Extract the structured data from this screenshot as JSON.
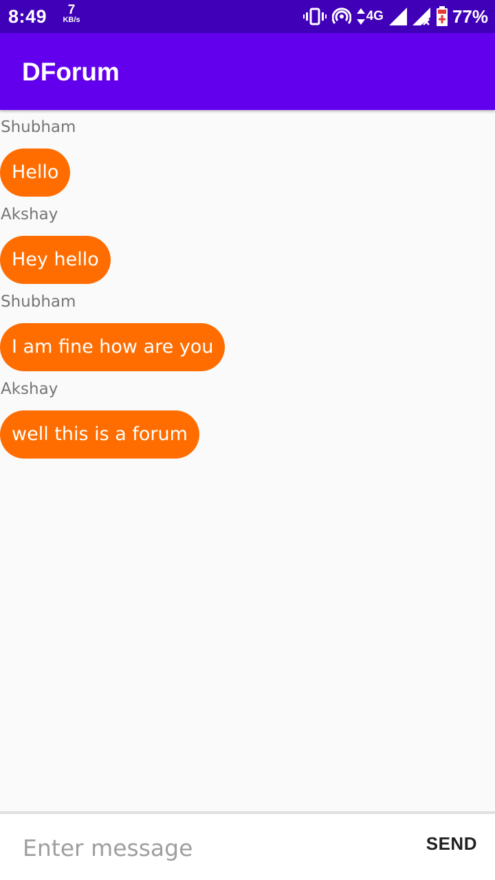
{
  "status_bar": {
    "time": "8:49",
    "speed_value": "7",
    "speed_unit": "KB/s",
    "network_type": "4G",
    "battery_percent": "77%",
    "icons": [
      "vibrate-icon",
      "hotspot-icon",
      "data-arrows-icon",
      "signal-icon",
      "signal-no-service-icon",
      "battery-charging-icon"
    ],
    "background_color": "#3f00b8"
  },
  "app_bar": {
    "title": "DForum",
    "background_color": "#6200ee"
  },
  "messages": [
    {
      "sender": "Shubham",
      "text": "Hello"
    },
    {
      "sender": "Akshay",
      "text": "Hey hello"
    },
    {
      "sender": "Shubham",
      "text": "I am fine how are you"
    },
    {
      "sender": "Akshay",
      "text": "well this is a forum"
    }
  ],
  "bubble_color": "#ff6d00",
  "composer": {
    "placeholder": "Enter message",
    "value": "",
    "send_label": "SEND"
  }
}
